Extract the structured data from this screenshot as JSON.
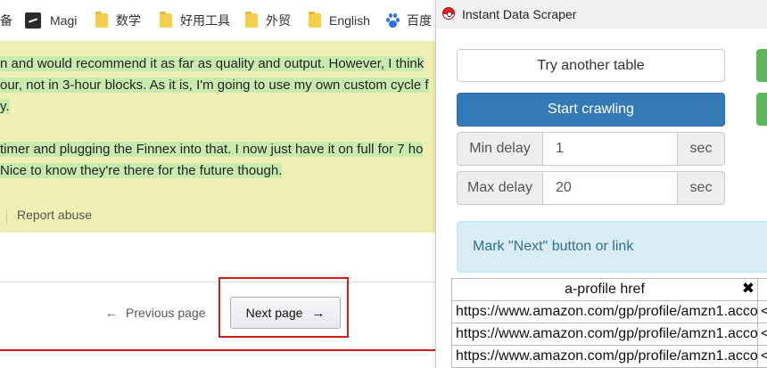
{
  "bookmarks": [
    {
      "icon": "folder-icon",
      "label": "备"
    },
    {
      "icon": "magi-icon",
      "label": "Magi"
    },
    {
      "icon": "folder-icon",
      "label": "数学"
    },
    {
      "icon": "folder-icon",
      "label": "好用工具"
    },
    {
      "icon": "folder-icon",
      "label": "外贸"
    },
    {
      "icon": "folder-icon",
      "label": "English"
    },
    {
      "icon": "baidu-paw-icon",
      "label": "百度"
    }
  ],
  "review": {
    "line1": "n and would recommend it as far as quality and output. However, I think",
    "line2": "our, not in 3-hour blocks. As it is, I'm going to use my own custom cycle f",
    "line3": "y.",
    "line4": "timer and plugging the Finnex into that. I now just have it on full for 7 ho",
    "line5": " Nice to know they're there for the future though.",
    "report_abuse": "Report abuse"
  },
  "pagination": {
    "prev_arrow": "←",
    "prev_label": "Previous page",
    "next_label": "Next page",
    "next_arrow": "→"
  },
  "popup": {
    "title": "Instant Data Scraper",
    "try_another_table": "Try another table",
    "start_crawling": "Start crawling",
    "min_delay": {
      "label": "Min delay",
      "value": "1",
      "unit": "sec"
    },
    "max_delay": {
      "label": "Max delay",
      "value": "20",
      "unit": "sec"
    },
    "mark_next": "Mark \"Next\" button or link",
    "table": {
      "column": "a-profile href",
      "close": "✖",
      "rows": [
        "https://www.amazon.com/gp/profile/amzn1.acco",
        "https://www.amazon.com/gp/profile/amzn1.acco",
        "https://www.amazon.com/gp/profile/amzn1.acco"
      ],
      "stub": "<"
    }
  },
  "colors": {
    "primary_button": "#337ab7",
    "success_button": "#5cb85c",
    "info_alert": "#d9edf7",
    "review_bg": "#eef0b4",
    "highlight_frame": "#d21b1b"
  }
}
